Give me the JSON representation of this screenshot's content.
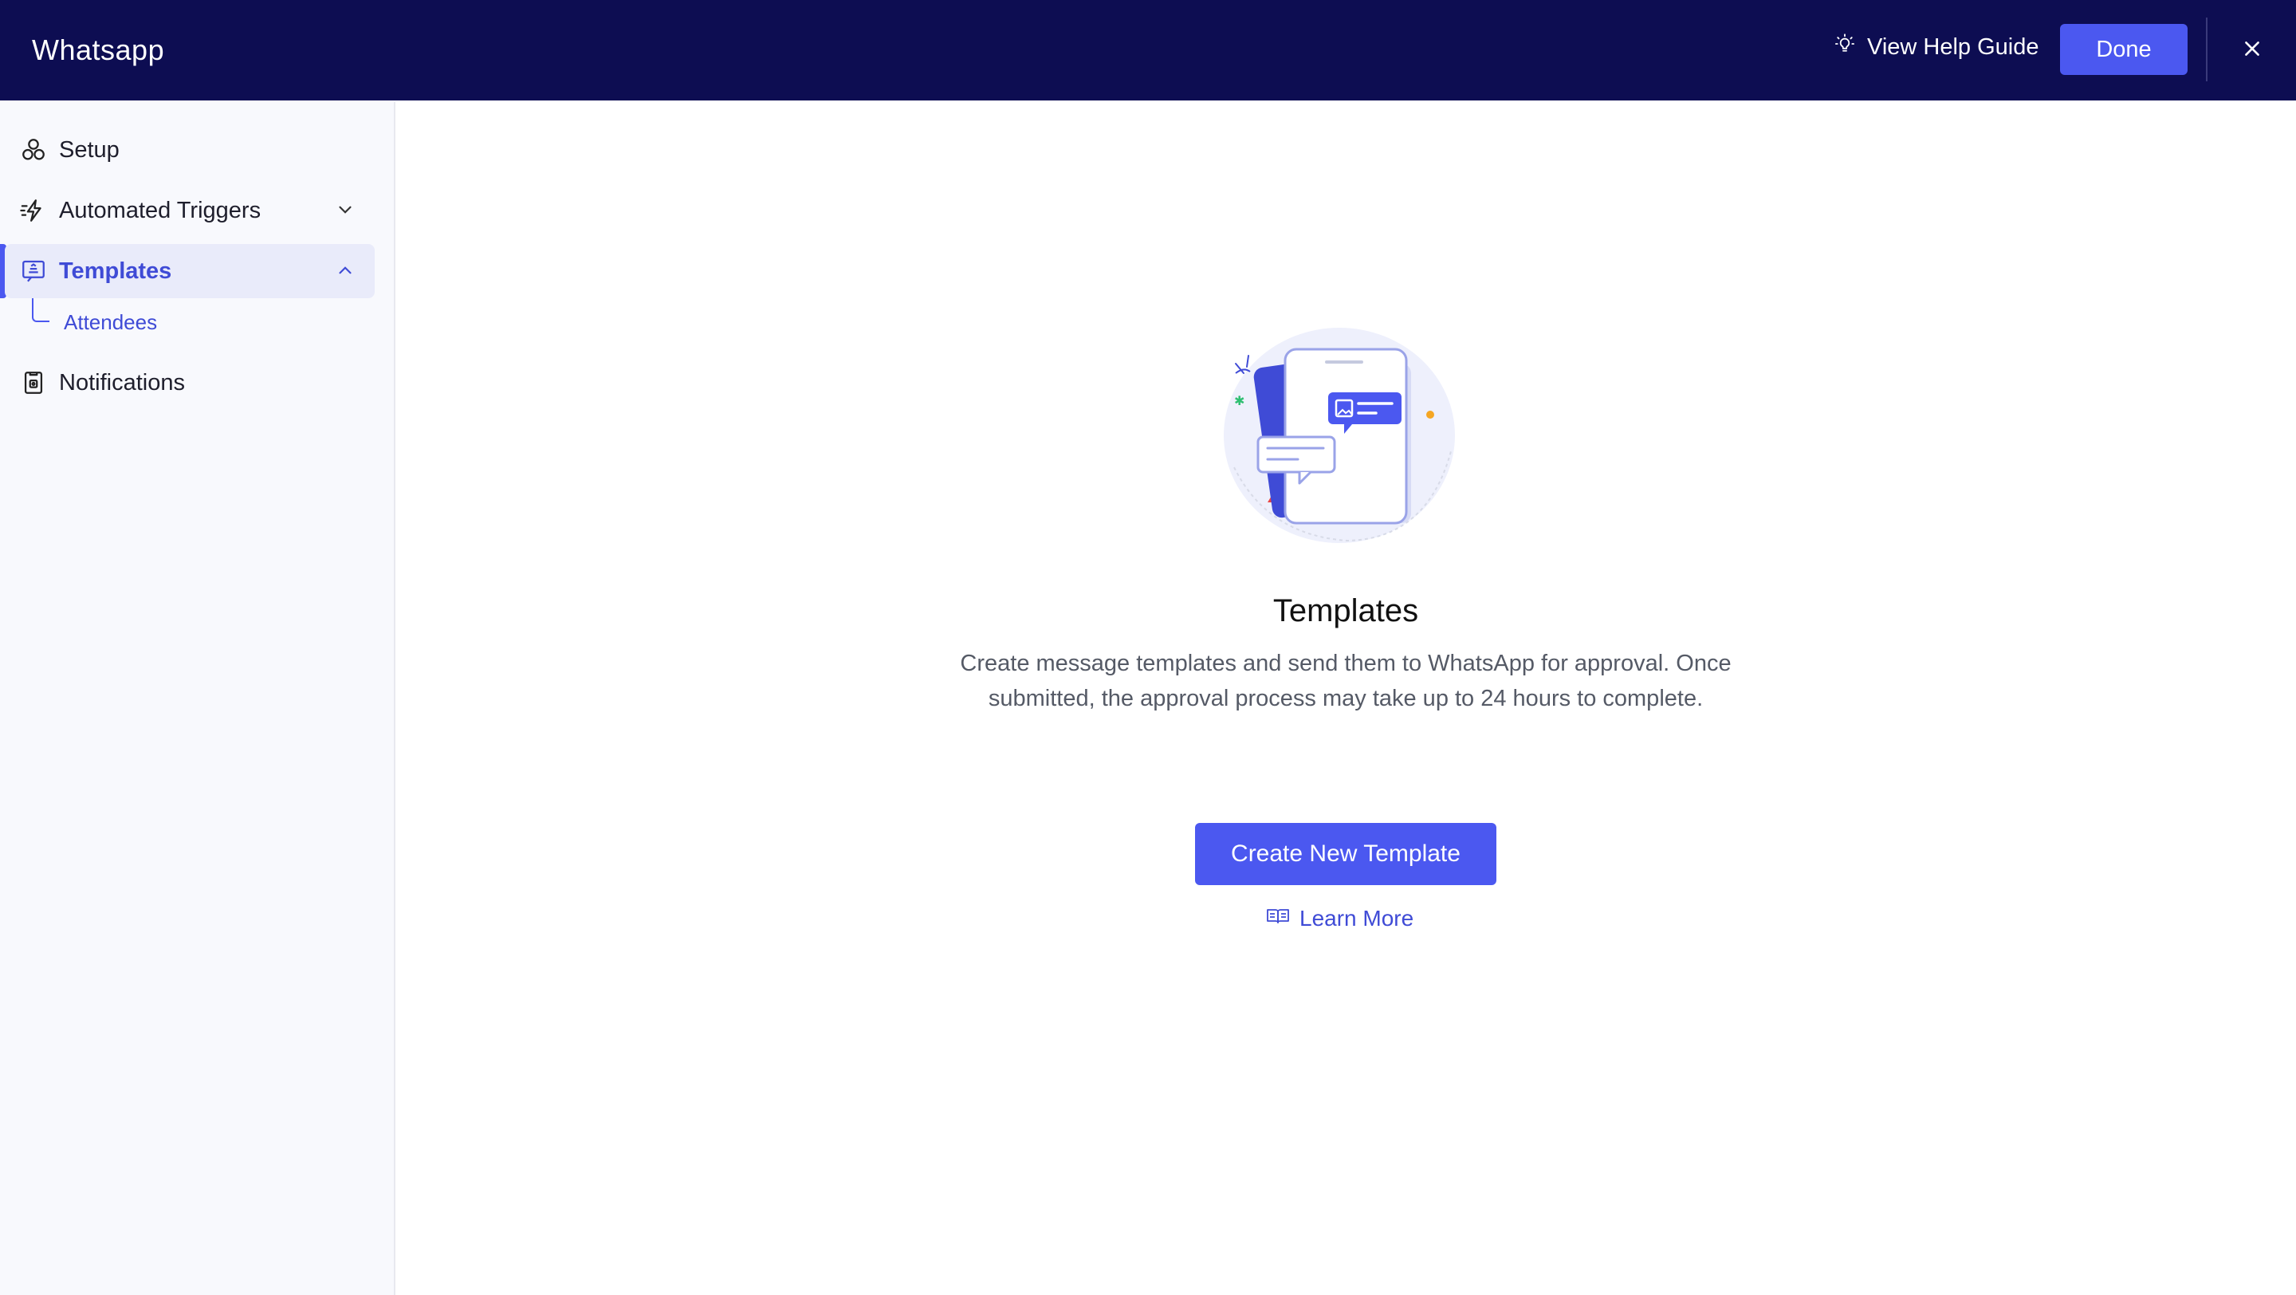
{
  "header": {
    "title": "Whatsapp",
    "help_label": "View Help Guide",
    "done_label": "Done",
    "bg_color": "#0d0d52"
  },
  "sidebar": {
    "items": [
      {
        "label": "Setup",
        "icon": "setup-icon"
      },
      {
        "label": "Automated Triggers",
        "icon": "triggers-icon",
        "chevron": "chevron-down-icon"
      },
      {
        "label": "Templates",
        "icon": "templates-icon",
        "chevron": "chevron-up-icon",
        "active": true,
        "children": [
          {
            "label": "Attendees"
          }
        ]
      },
      {
        "label": "Notifications",
        "icon": "notifications-icon"
      }
    ]
  },
  "main": {
    "empty_state": {
      "title": "Templates",
      "description": "Create message templates and send them to WhatsApp for approval. Once submitted, the approval process may take up to 24 hours to complete.",
      "primary_button": "Create New Template",
      "link_label": "Learn More"
    }
  },
  "colors": {
    "accent": "#4b58f0",
    "active_text": "#3f4bd6",
    "sidebar_bg": "#f8f9fd"
  }
}
